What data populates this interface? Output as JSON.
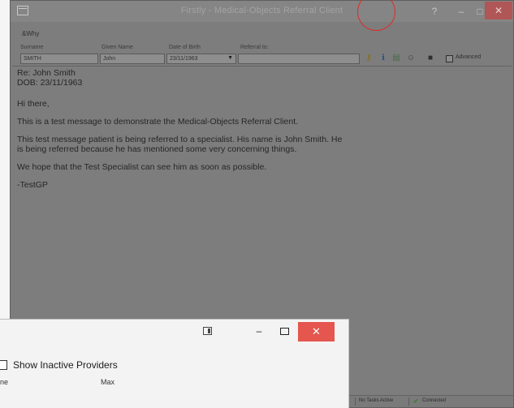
{
  "main_window": {
    "title": "Firstly - Medical-Objects Referral Client",
    "help_glyph": "?",
    "min_glyph": "–",
    "max_glyph": "□",
    "close_glyph": "✕",
    "menu_label": "&Why",
    "fields": {
      "surname_label": "Surname",
      "given_name_label": "Given Name",
      "dob_label": "Date of Birth",
      "referral_label": "Referral to:",
      "surname_value": "SMITH",
      "given_name_value": "John",
      "dob_value": "23/11/1963",
      "referral_value": ""
    },
    "advanced_label": "Advanced",
    "message_lines": [
      "Re: John Smith",
      "DOB: 23/11/1963",
      "Hi there,",
      "This is a test message to demonstrate the Medical-Objects Referral Client.",
      "This test message patient is being referred to a specialist. His name is John Smith. He",
      "is being referred because he has mentioned some very concerning things.",
      "We hope that the Test Specialist can see him as soon as possible.",
      "-TestGP"
    ],
    "status": {
      "tasks": "No Tasks Active",
      "connection": "Connected"
    },
    "colors": {
      "close_accent": "#b15656",
      "annotation_circle": "#e02a2a"
    }
  },
  "dialog": {
    "min_glyph": "–",
    "close_glyph": "✕",
    "show_inactive_label": "Show Inactive Providers",
    "col_left": "ne",
    "col_max": "Max",
    "colors": {
      "close_bg": "#e4564e"
    }
  }
}
